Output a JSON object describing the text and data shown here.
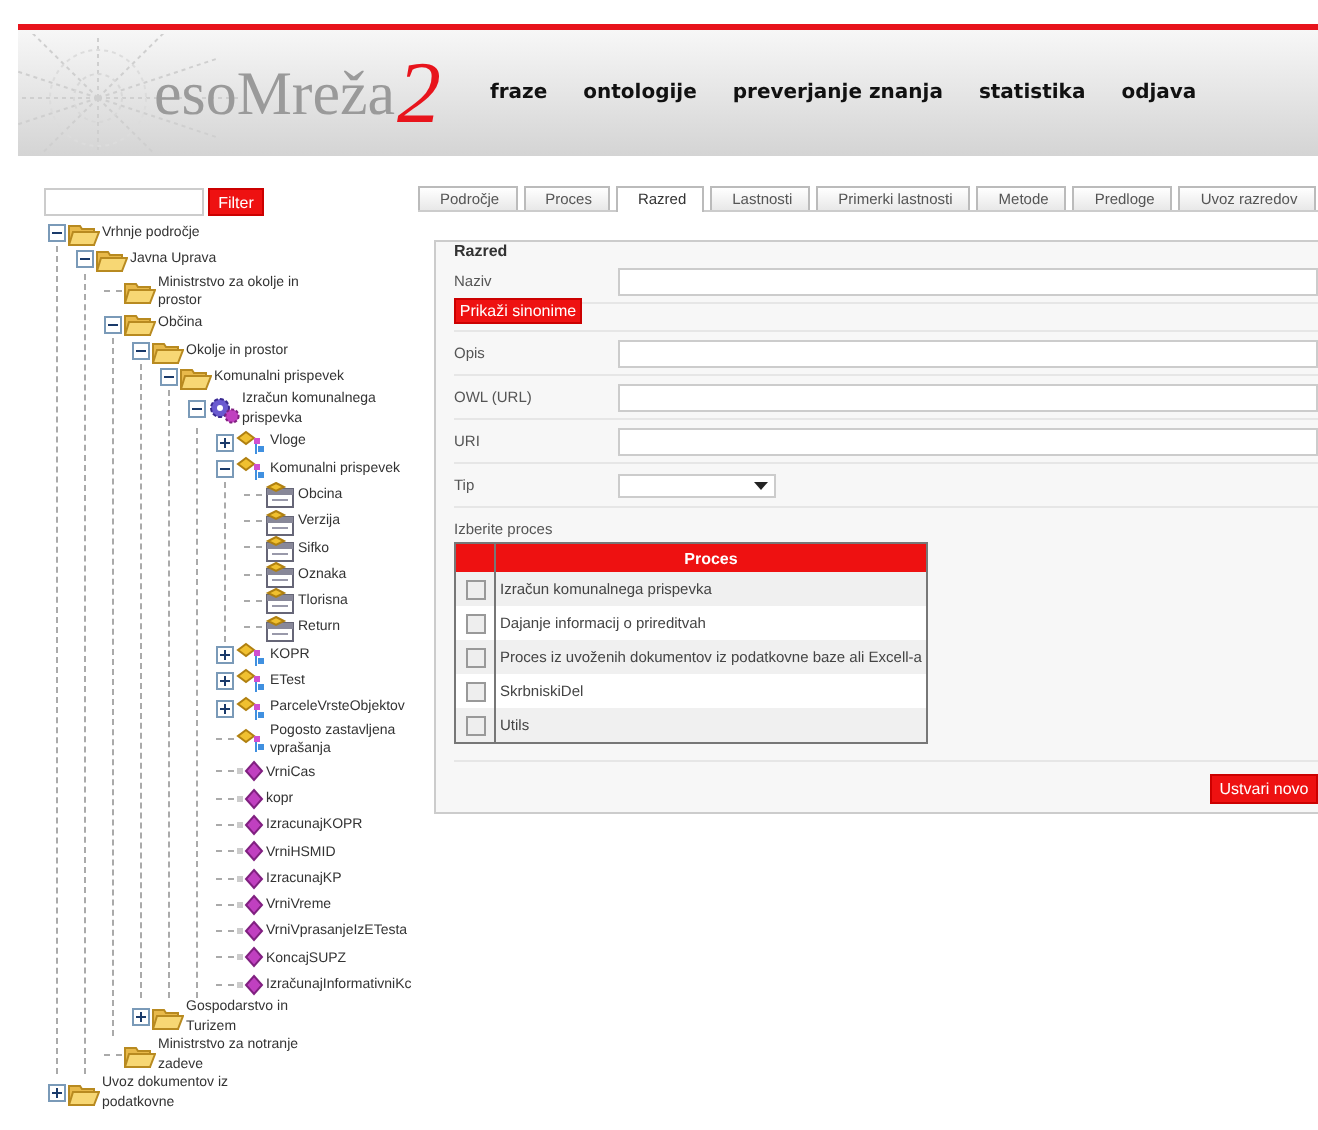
{
  "header": {
    "logo_text": "esoMreža",
    "logo_mark": "2",
    "nav": [
      "fraze",
      "ontologije",
      "preverjanje znanja",
      "statistika",
      "odjava"
    ]
  },
  "filter": {
    "button": "Filter"
  },
  "tree": [
    {
      "label": "Vrhnje področje",
      "kind": "folder",
      "expanded": true,
      "children": [
        {
          "label": "Javna Uprava",
          "kind": "folder",
          "expanded": true,
          "children": [
            {
              "label": "Ministrstvo za okolje in prostor",
              "kind": "folder"
            },
            {
              "label": "Občina",
              "kind": "folder",
              "expanded": true,
              "children": [
                {
                  "label": "Okolje in prostor",
                  "kind": "folder",
                  "expanded": true,
                  "children": [
                    {
                      "label": "Komunalni prispevek",
                      "kind": "folder",
                      "expanded": true,
                      "children": [
                        {
                          "label": "Izračun komunalnega prispevka",
                          "kind": "process",
                          "expanded": true,
                          "children": [
                            {
                              "label": "Vloge",
                              "kind": "class",
                              "expanded": false
                            },
                            {
                              "label": "Komunalni prispevek",
                              "kind": "class",
                              "expanded": true,
                              "children": [
                                {
                                  "label": "Obcina",
                                  "kind": "property"
                                },
                                {
                                  "label": "Verzija",
                                  "kind": "property"
                                },
                                {
                                  "label": "Sifko",
                                  "kind": "property"
                                },
                                {
                                  "label": "Oznaka",
                                  "kind": "property"
                                },
                                {
                                  "label": "Tlorisna",
                                  "kind": "property"
                                },
                                {
                                  "label": "Return",
                                  "kind": "property"
                                }
                              ]
                            },
                            {
                              "label": "KOPR",
                              "kind": "class",
                              "expanded": false
                            },
                            {
                              "label": "ETest",
                              "kind": "class",
                              "expanded": false
                            },
                            {
                              "label": "ParceleVrsteObjektov",
                              "kind": "class",
                              "expanded": false
                            },
                            {
                              "label": "Pogosto zastavljena vprašanja",
                              "kind": "class"
                            },
                            {
                              "label": "VrniCas",
                              "kind": "method"
                            },
                            {
                              "label": "kopr",
                              "kind": "method"
                            },
                            {
                              "label": "IzracunajKOPR",
                              "kind": "method"
                            },
                            {
                              "label": "VrniHSMID",
                              "kind": "method"
                            },
                            {
                              "label": "IzracunajKP",
                              "kind": "method"
                            },
                            {
                              "label": "VrniVreme",
                              "kind": "method"
                            },
                            {
                              "label": "VrniVprasanjeIzETesta",
                              "kind": "method"
                            },
                            {
                              "label": "KoncajSUPZ",
                              "kind": "method"
                            },
                            {
                              "label": "IzračunajInformativniKc",
                              "kind": "method"
                            }
                          ]
                        }
                      ]
                    }
                  ]
                },
                {
                  "label": "Gospodarstvo in Turizem",
                  "kind": "folder",
                  "expanded": false
                }
              ]
            },
            {
              "label": "Ministrstvo za notranje zadeve",
              "kind": "folder"
            }
          ]
        }
      ]
    },
    {
      "label": "Uvoz dokumentov iz podatkovne",
      "kind": "folder",
      "expanded": false
    }
  ],
  "tabs": [
    {
      "label": "Področje",
      "selected": false
    },
    {
      "label": "Proces",
      "selected": false
    },
    {
      "label": "Razred",
      "selected": true
    },
    {
      "label": "Lastnosti",
      "selected": false
    },
    {
      "label": "Primerki lastnosti",
      "selected": false
    },
    {
      "label": "Metode",
      "selected": false
    },
    {
      "label": "Predloge",
      "selected": false
    },
    {
      "label": "Uvoz razredov",
      "selected": false
    }
  ],
  "form": {
    "legend": "Razred",
    "fields": [
      {
        "label": "Naziv",
        "kind": "text"
      },
      {
        "label": "Prikaži sinonime",
        "kind": "button"
      },
      {
        "label": "Opis",
        "kind": "text"
      },
      {
        "label": "OWL (URL)",
        "kind": "text"
      },
      {
        "label": "URI",
        "kind": "text"
      },
      {
        "label": "Tip",
        "kind": "select"
      }
    ],
    "process_label": "Izberite proces",
    "table": {
      "header": "Proces",
      "rows": [
        {
          "name": "Izračun komunalnega prispevka",
          "checked": false
        },
        {
          "name": "Dajanje informacij o prireditvah",
          "checked": false
        },
        {
          "name": "Proces iz uvoženih dokumentov iz podatkovne baze ali Excell-a",
          "checked": false
        },
        {
          "name": "SkrbniskiDel",
          "checked": false
        },
        {
          "name": "Utils",
          "checked": false
        }
      ]
    },
    "submit": "Ustvari novo"
  }
}
